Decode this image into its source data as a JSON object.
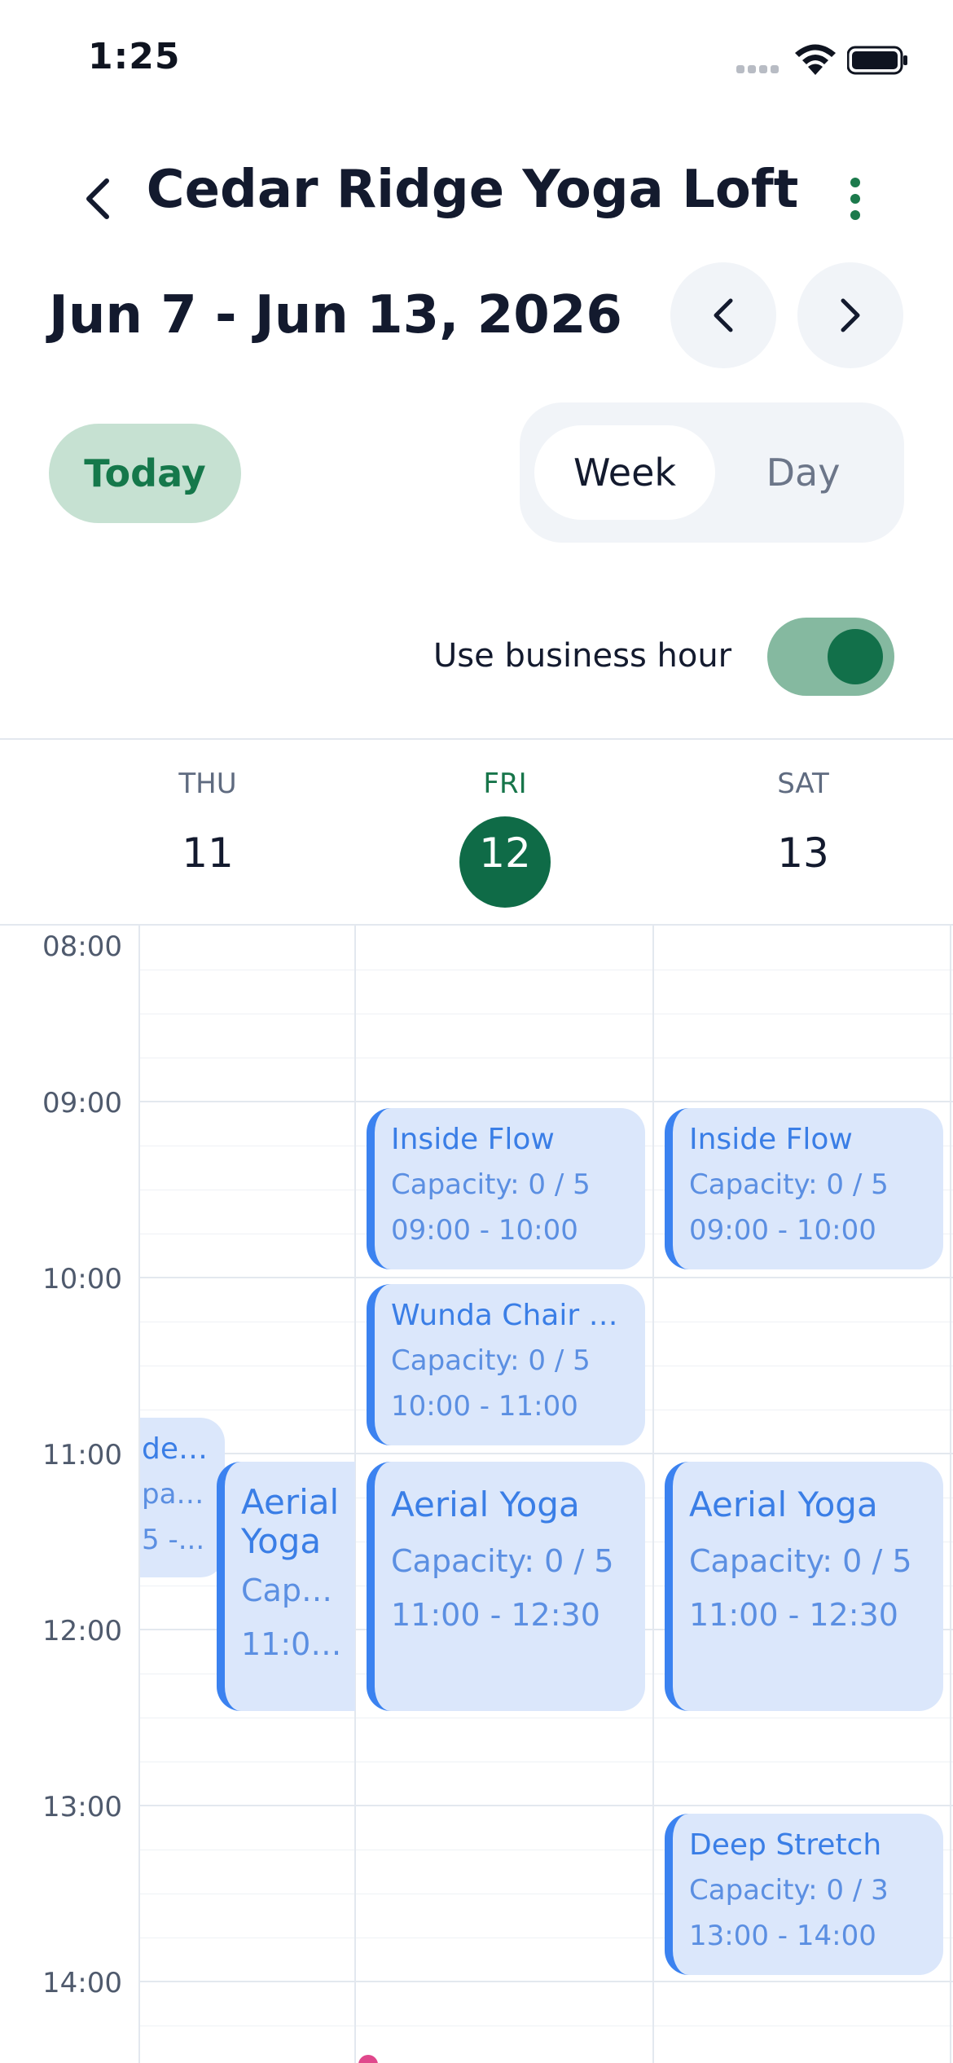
{
  "status_bar": {
    "time": "1:25"
  },
  "header": {
    "title": "Cedar Ridge Yoga Loft",
    "back_icon": "chevron-left-icon",
    "more_icon": "more-vertical-icon"
  },
  "date_nav": {
    "range": "Jun 7 - Jun 13, 2026",
    "prev_icon": "chevron-left-icon",
    "next_icon": "chevron-right-icon"
  },
  "controls": {
    "today_label": "Today",
    "views": [
      "Week",
      "Day"
    ],
    "selected_view": "Week",
    "business_hour_label": "Use business hour",
    "business_hour_enabled": true
  },
  "days": [
    {
      "name": "THU",
      "num": "11"
    },
    {
      "name": "FRI",
      "num": "12",
      "today": true
    },
    {
      "name": "SAT",
      "num": "13"
    }
  ],
  "time_labels": [
    "08:00",
    "09:00",
    "10:00",
    "11:00",
    "12:00",
    "13:00",
    "14:00"
  ],
  "events": {
    "thu_partial": {
      "title": "de ...",
      "cap": "paci...",
      "time": "5 -..."
    },
    "thu_aerial": {
      "title": "Aerial Yoga",
      "cap": "Capac...",
      "time": "11:00 ..."
    },
    "fri_inside": {
      "title": "Inside Flow",
      "cap": "Capacity: 0 / 5",
      "time": "09:00 - 10:00"
    },
    "fri_wunda": {
      "title": "Wunda Chair B...",
      "cap": "Capacity: 0 / 5",
      "time": "10:00 - 11:00"
    },
    "fri_aerial": {
      "title": "Aerial Yoga",
      "cap": "Capacity: 0 / 5",
      "time": "11:00 - 12:30"
    },
    "sat_inside": {
      "title": "Inside Flow",
      "cap": "Capacity: 0 / 5",
      "time": "09:00 - 10:00"
    },
    "sat_aerial": {
      "title": "Aerial Yoga",
      "cap": "Capacity: 0 / 5",
      "time": "11:00 - 12:30"
    },
    "sat_deep": {
      "title": "Deep Stretch",
      "cap": "Capacity: 0 / 3",
      "time": "13:00 - 14:00"
    }
  },
  "colors": {
    "accent": "#0f6b47",
    "event_bg": "#dbe7fb",
    "event_border": "#3b82f0"
  }
}
